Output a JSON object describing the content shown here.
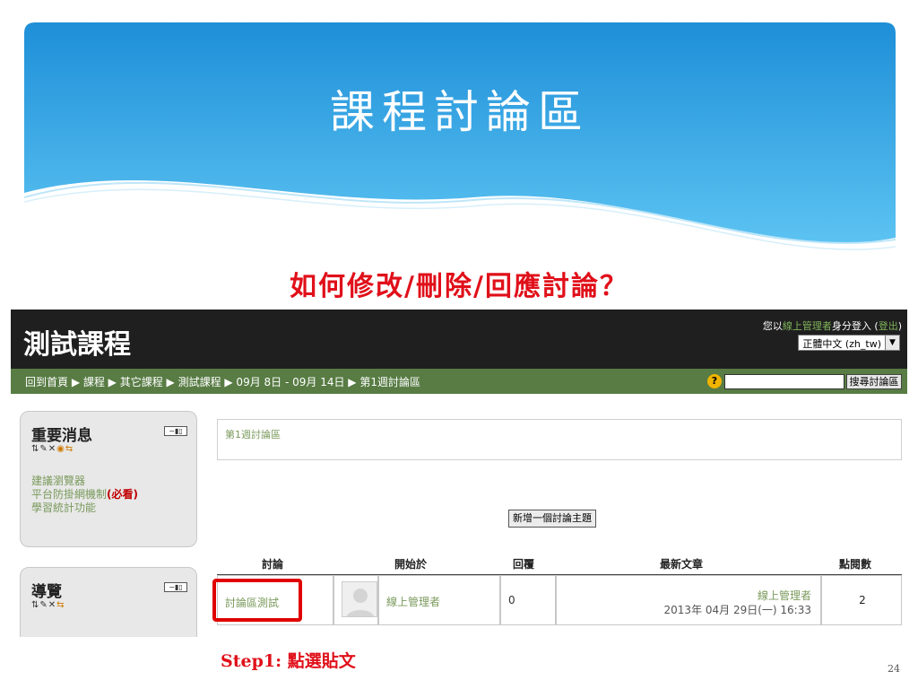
{
  "slide": {
    "title": "課程討論區",
    "question": "如何修改/刪除/回應討論？",
    "step": "Step1: 點選貼文",
    "page_number": "24"
  },
  "header": {
    "course_title": "測試課程",
    "login_prefix": "您以",
    "login_user": "線上管理者",
    "login_suffix": "身分登入 (",
    "logout": "登出",
    "login_close": ")",
    "language": "正體中文 (zh_tw)"
  },
  "navbar": {
    "breadcrumb": "回到首頁 ▶ 課程 ▶ 其它課程 ▶ 測試課程 ▶ 09月 8日 - 09月 14日 ▶ 第1週討論區",
    "search_button": "搜尋討論區"
  },
  "blocks": {
    "news": {
      "title": "重要消息",
      "links": [
        "建議瀏覽器",
        "平台防掛網機制",
        "學習統計功能"
      ],
      "must_read": "(必看)"
    },
    "nav": {
      "title": "導覽"
    }
  },
  "main": {
    "forum_name": "第1週討論區",
    "add_topic_button": "新增一個討論主題",
    "columns": [
      "討論",
      "開始於",
      "回覆",
      "最新文章",
      "點閱數"
    ],
    "rows": [
      {
        "discussion": "討論區測試",
        "started_by": "線上管理者",
        "replies": "0",
        "latest_user": "線上管理者",
        "latest_date": "2013年 04月 29日(一) 16:33",
        "views": "2"
      }
    ]
  },
  "colors": {
    "accent_red": "#e0101a",
    "nav_green": "#587c44",
    "link_green": "#7a9a5c",
    "header_blue": "#2a9fe0"
  }
}
